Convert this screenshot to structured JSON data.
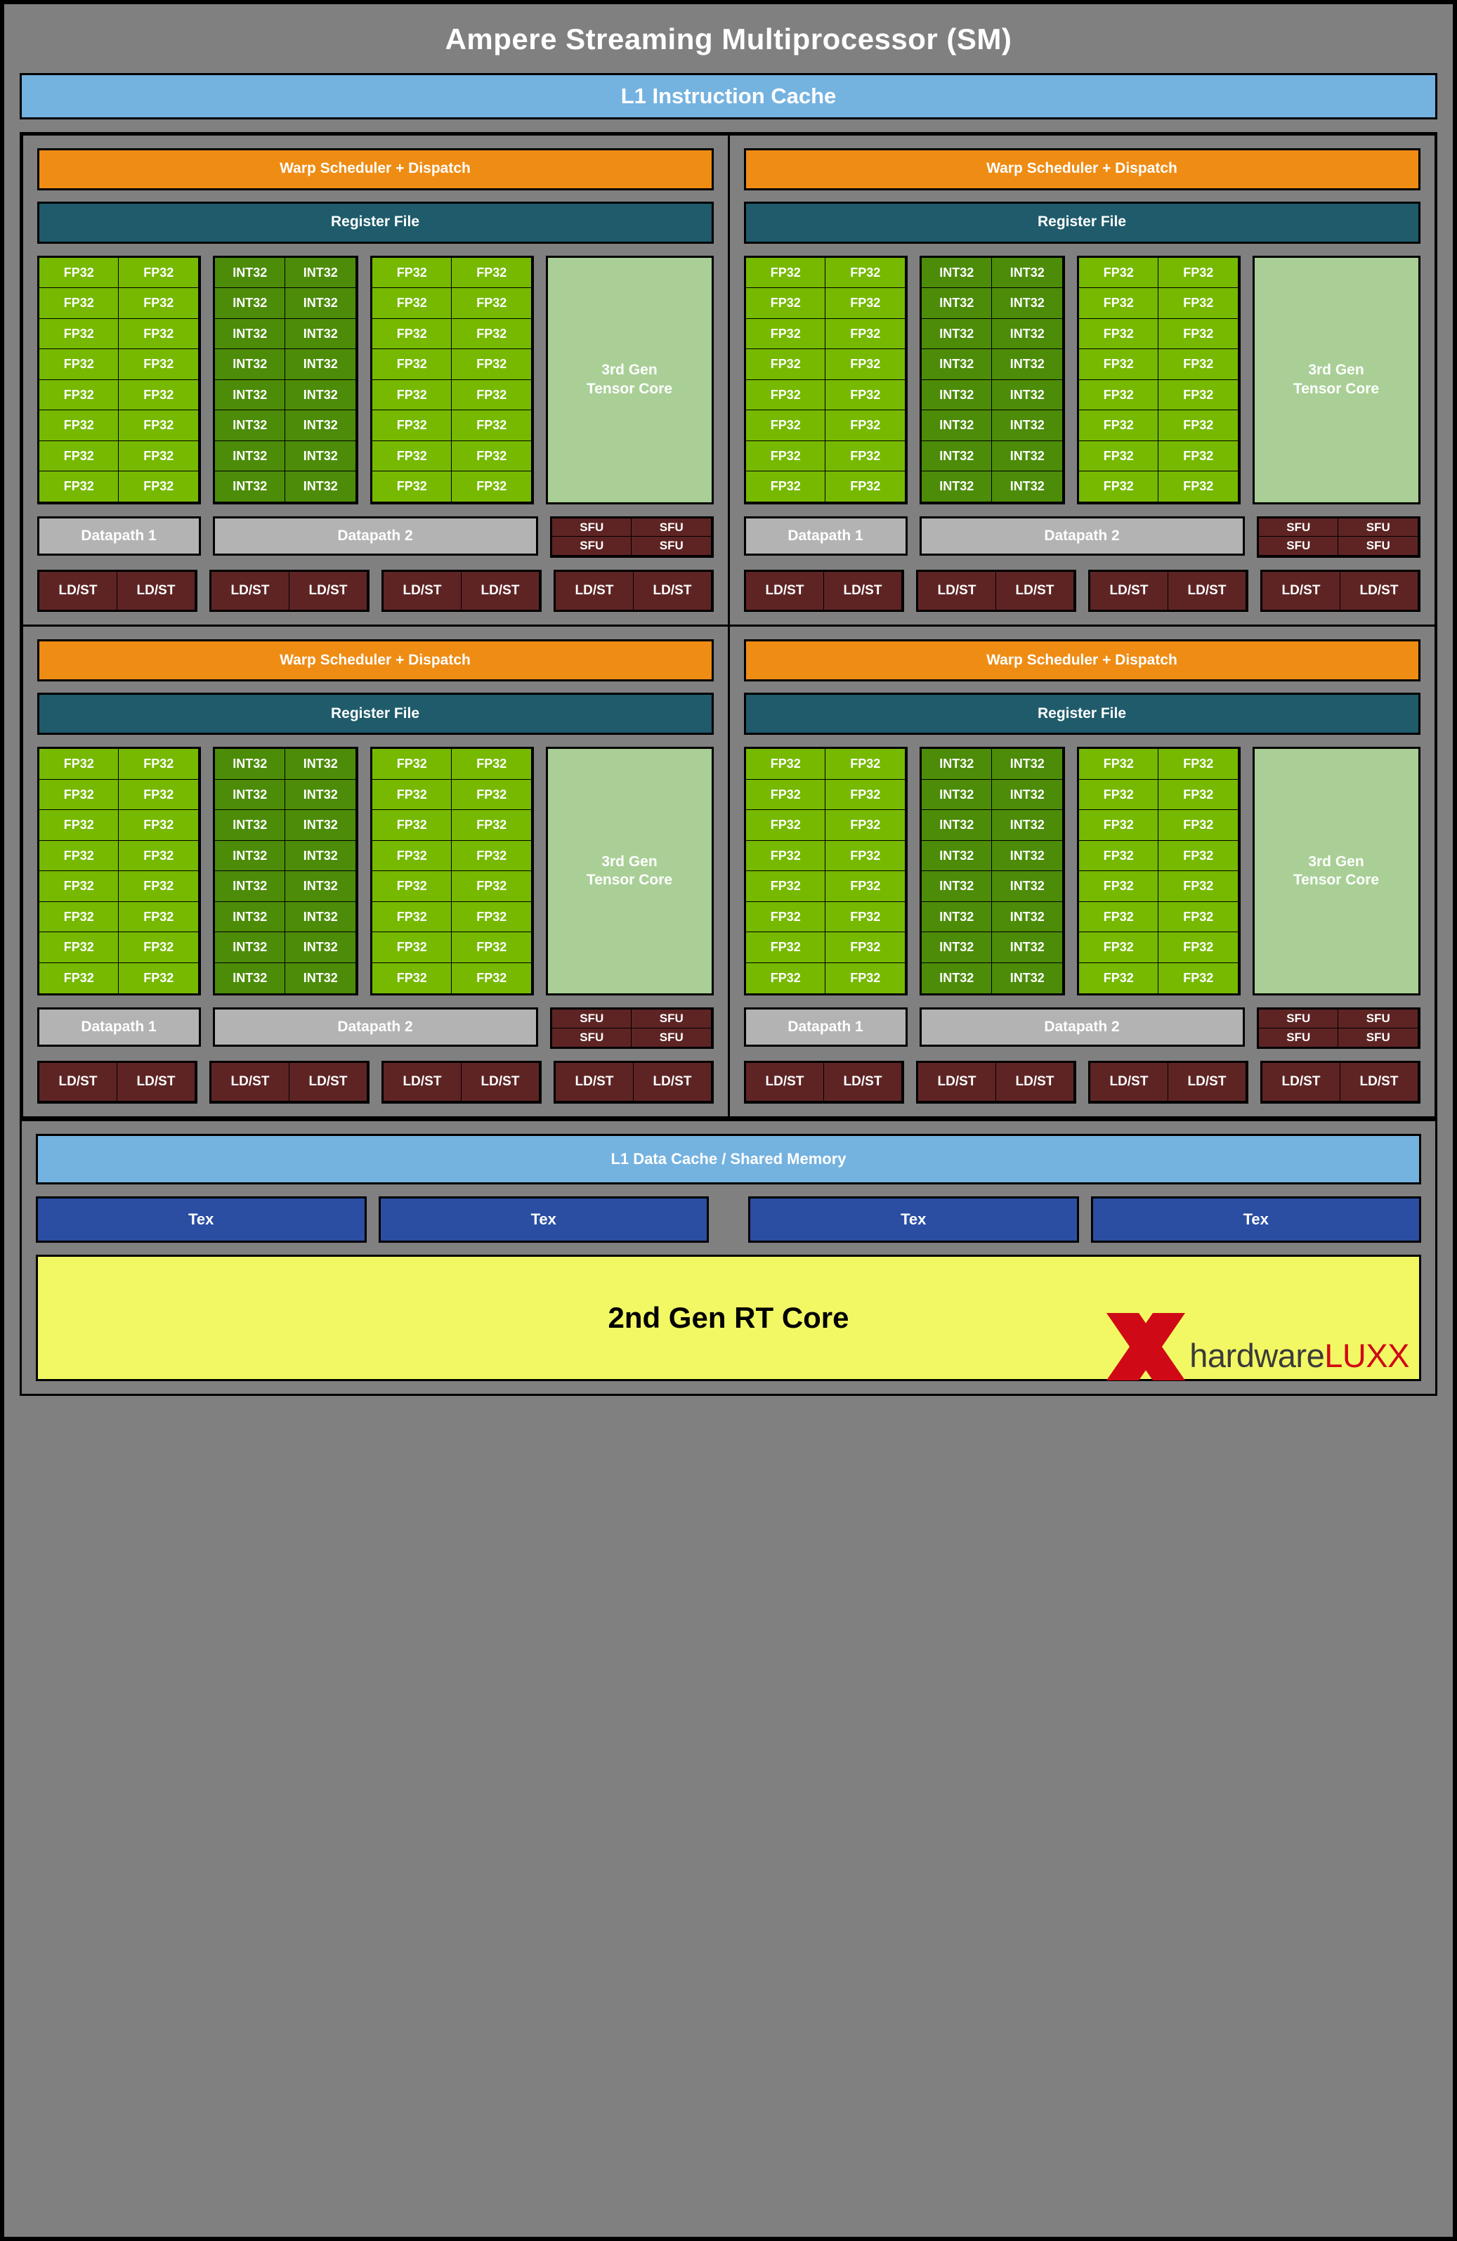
{
  "title": "Ampere Streaming Multiprocessor (SM)",
  "l1_instruction_cache": "L1 Instruction Cache",
  "labels": {
    "warp_scheduler": "Warp Scheduler + Dispatch",
    "register_file": "Register File",
    "fp32": "FP32",
    "int32": "INT32",
    "tensor_core": "3rd Gen\nTensor Core",
    "tensor_core_line1": "3rd Gen",
    "tensor_core_line2": "Tensor Core",
    "datapath1": "Datapath 1",
    "datapath2": "Datapath 2",
    "sfu": "SFU",
    "ldst": "LD/ST",
    "l1_data_cache": "L1 Data Cache / Shared Memory",
    "tex": "Tex",
    "rt_core": "2nd Gen RT Core"
  },
  "counts": {
    "processing_blocks": 4,
    "core_rows_per_block": 8,
    "fp32_group1_columns": 2,
    "int32_group_columns": 2,
    "fp32_group2_columns": 2,
    "fp32_per_block": 32,
    "int32_per_block": 16,
    "tensor_cores_per_block": 1,
    "sfu_per_block": 4,
    "ldst_per_block": 8,
    "tex_units": 4,
    "rt_cores": 1
  },
  "colors": {
    "background": "#808080",
    "border": "#000000",
    "cache_blue": "#74b2e0",
    "warp_orange": "#ef8c14",
    "register_teal": "#1f5b6b",
    "fp32_green": "#76b900",
    "int32_green": "#4c8c09",
    "tensor_green": "#a9cf96",
    "datapath_gray": "#b3b3b3",
    "sfu_ldst_maroon": "#5e2424",
    "tex_blue": "#2b4ea2",
    "rt_yellow": "#f2f863",
    "logo_red": "#cf0a16",
    "logo_dark": "#3a3a3a"
  },
  "logo": {
    "mark": "double-x-mark",
    "word_primary": "hardware",
    "word_accent": "LUXX"
  }
}
